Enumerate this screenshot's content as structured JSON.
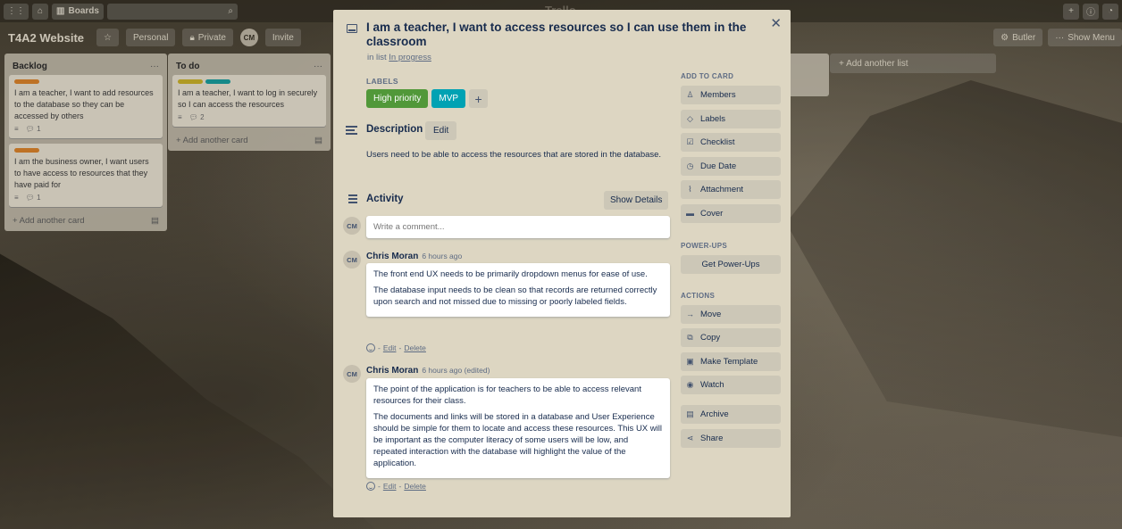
{
  "topbar": {
    "boards_label": "Boards",
    "logo_text": "Trello"
  },
  "board": {
    "title": "T4A2 Website",
    "personal_label": "Personal",
    "private_label": "Private",
    "avatar_initials": "CM",
    "invite_label": "Invite",
    "butler_label": "Butler",
    "show_menu_label": "Show Menu",
    "add_list_label": "+ Add another list"
  },
  "lists": [
    {
      "title": "Backlog",
      "cards": [
        {
          "label_colors": [
            "#d9822b"
          ],
          "text": "I am a teacher, I want to add resources to the database so they can be accessed by others",
          "comments": "1"
        },
        {
          "label_colors": [
            "#d9822b"
          ],
          "text": "I am the business owner, I want users to have access to resources that they have paid for",
          "comments": "1"
        }
      ],
      "add_card": "+ Add another card"
    },
    {
      "title": "To do",
      "cards": [
        {
          "label_colors": [
            "#c8b02a",
            "#1a9c9c"
          ],
          "text": "I am a teacher, I want to log in securely so I can access the resources",
          "comments": "2"
        }
      ],
      "add_card": "+ Add another card"
    }
  ],
  "modal": {
    "title": "I am a teacher, I want to access resources so I can use them in the classroom",
    "in_list_prefix": "in list",
    "in_list_name": "In progress",
    "labels_heading": "LABELS",
    "labels": [
      {
        "text": "High priority",
        "color": "#519839"
      },
      {
        "text": "MVP",
        "color": "#00a2b3"
      }
    ],
    "description_heading": "Description",
    "edit_label": "Edit",
    "description": "Users need to be able to access the resources that are stored in the database.",
    "activity_heading": "Activity",
    "show_details_label": "Show Details",
    "user_initials": "CM",
    "comment_placeholder": "Write a comment...",
    "comments": [
      {
        "author": "Chris Moran",
        "time": "6 hours ago",
        "paragraphs": [
          "The front end UX needs to be primarily dropdown menus for ease of use.",
          "The database input needs to be clean so that records are returned correctly upon search and not missed due to missing or poorly labeled fields."
        ],
        "edit": "Edit",
        "delete": "Delete"
      },
      {
        "author": "Chris Moran",
        "time": "6 hours ago (edited)",
        "paragraphs": [
          "The point of the application is for teachers to be able to access relevant resources for their class.",
          "The documents and links will be stored in a database and User Experience should be simple for them to locate and access these resources. This UX will be important as the computer literacy of some users will be low, and repeated interaction with the database will highlight the value of the application."
        ],
        "edit": "Edit",
        "delete": "Delete"
      }
    ]
  },
  "sidebar": {
    "add_to_card_heading": "ADD TO CARD",
    "add_to_card": [
      {
        "label": "Members",
        "icon": "person-icon"
      },
      {
        "label": "Labels",
        "icon": "tag-icon"
      },
      {
        "label": "Checklist",
        "icon": "checklist-icon"
      },
      {
        "label": "Due Date",
        "icon": "clock-icon"
      },
      {
        "label": "Attachment",
        "icon": "paperclip-icon"
      },
      {
        "label": "Cover",
        "icon": "cover-icon"
      }
    ],
    "power_ups_heading": "POWER-UPS",
    "get_power_ups": "Get Power-Ups",
    "actions_heading": "ACTIONS",
    "actions": [
      {
        "label": "Move",
        "icon": "arrow-right-icon"
      },
      {
        "label": "Copy",
        "icon": "copy-icon"
      },
      {
        "label": "Make Template",
        "icon": "template-icon"
      },
      {
        "label": "Watch",
        "icon": "eye-icon"
      },
      {
        "label": "Archive",
        "icon": "archive-icon"
      },
      {
        "label": "Share",
        "icon": "share-icon"
      }
    ]
  }
}
